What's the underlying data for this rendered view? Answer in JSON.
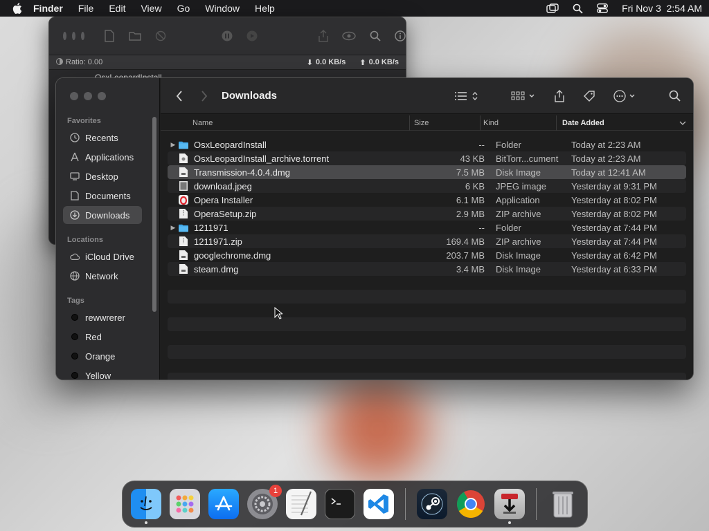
{
  "menubar": {
    "app_name": "Finder",
    "items": [
      "File",
      "Edit",
      "View",
      "Go",
      "Window",
      "Help"
    ],
    "clock": "Fri Nov 3  2:54 AM"
  },
  "transmission": {
    "ratio": "Ratio: 0.00",
    "download_rate": "0.0 KB/s",
    "upload_rate": "0.0 KB/s",
    "torrent_name": "OsxLeopardInstall"
  },
  "finder": {
    "title": "Downloads",
    "sidebar": {
      "favorites_label": "Favorites",
      "favorites": [
        "Recents",
        "Applications",
        "Desktop",
        "Documents",
        "Downloads"
      ],
      "locations_label": "Locations",
      "locations": [
        "iCloud Drive",
        "Network"
      ],
      "tags_label": "Tags",
      "tags": [
        "rewwrerer",
        "Red",
        "Orange",
        "Yellow"
      ]
    },
    "columns": {
      "name": "Name",
      "size": "Size",
      "kind": "Kind",
      "date": "Date Added"
    },
    "files": [
      {
        "name": "OsxLeopardInstall",
        "size": "--",
        "kind": "Folder",
        "date": "Today at 2:23 AM",
        "type": "folder"
      },
      {
        "name": "OsxLeopardInstall_archive.torrent",
        "size": "43 KB",
        "kind": "BitTorr...cument",
        "date": "Today at 2:23 AM",
        "type": "doc"
      },
      {
        "name": "Transmission-4.0.4.dmg",
        "size": "7.5 MB",
        "kind": "Disk Image",
        "date": "Today at 12:41 AM",
        "type": "dmg"
      },
      {
        "name": "download.jpeg",
        "size": "6 KB",
        "kind": "JPEG image",
        "date": "Yesterday at 9:31 PM",
        "type": "image"
      },
      {
        "name": "Opera Installer",
        "size": "6.1 MB",
        "kind": "Application",
        "date": "Yesterday at 8:02 PM",
        "type": "app"
      },
      {
        "name": "OperaSetup.zip",
        "size": "2.9 MB",
        "kind": "ZIP archive",
        "date": "Yesterday at 8:02 PM",
        "type": "doc"
      },
      {
        "name": "1211971",
        "size": "--",
        "kind": "Folder",
        "date": "Yesterday at 7:44 PM",
        "type": "folder"
      },
      {
        "name": "1211971.zip",
        "size": "169.4 MB",
        "kind": "ZIP archive",
        "date": "Yesterday at 7:44 PM",
        "type": "doc"
      },
      {
        "name": "googlechrome.dmg",
        "size": "203.7 MB",
        "kind": "Disk Image",
        "date": "Yesterday at 6:42 PM",
        "type": "dmg"
      },
      {
        "name": "steam.dmg",
        "size": "3.4 MB",
        "kind": "Disk Image",
        "date": "Yesterday at 6:33 PM",
        "type": "dmg"
      }
    ],
    "selected_index": 2
  },
  "dock": {
    "badge_count": "1"
  }
}
